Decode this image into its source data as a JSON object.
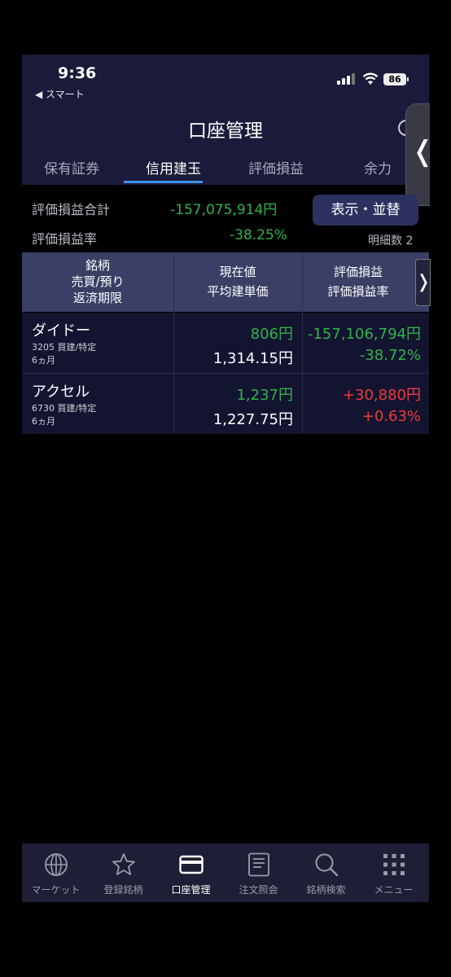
{
  "status": {
    "time": "9:36",
    "back_label": "◀ スマート",
    "battery": "86"
  },
  "header": {
    "title": "口座管理"
  },
  "tabs": [
    {
      "label": "保有証券"
    },
    {
      "label": "信用建玉"
    },
    {
      "label": "評価損益"
    },
    {
      "label": "余力"
    }
  ],
  "summary": {
    "total_label": "評価損益合計",
    "total_value": "-157,075,914円",
    "rate_label": "評価損益率",
    "rate_value": "-38.25%",
    "display_button": "表示・並替",
    "detail_count_label": "明細数",
    "detail_count": "2"
  },
  "table": {
    "headers": {
      "col1": [
        "銘柄",
        "売買/預り",
        "返済期限"
      ],
      "col2": [
        "現在値",
        "平均建単価"
      ],
      "col3": [
        "評価損益",
        "評価損益率"
      ]
    },
    "rows": [
      {
        "name": "ダイドー",
        "code_info": "3205 買建/特定",
        "term": "6ヵ月",
        "price": "806円",
        "avg_price": "1,314.15円",
        "pl": "-157,106,794円",
        "pl_rate": "-38.72%",
        "trend": "down"
      },
      {
        "name": "アクセル",
        "code_info": "6730 買建/特定",
        "term": "6ヵ月",
        "price": "1,237円",
        "avg_price": "1,227.75円",
        "pl": "+30,880円",
        "pl_rate": "+0.63%",
        "trend": "up"
      }
    ]
  },
  "tabbar": [
    {
      "label": "マーケット",
      "icon": "globe-icon"
    },
    {
      "label": "登録銘柄",
      "icon": "star-icon"
    },
    {
      "label": "口座管理",
      "icon": "card-icon",
      "active": true
    },
    {
      "label": "注文照会",
      "icon": "document-icon"
    },
    {
      "label": "銘柄検索",
      "icon": "search-icon"
    },
    {
      "label": "メニュー",
      "icon": "grid-icon"
    }
  ],
  "colors": {
    "positive": "#ee3a3a",
    "negative": "#31b34a",
    "accent": "#3d8fe6"
  }
}
